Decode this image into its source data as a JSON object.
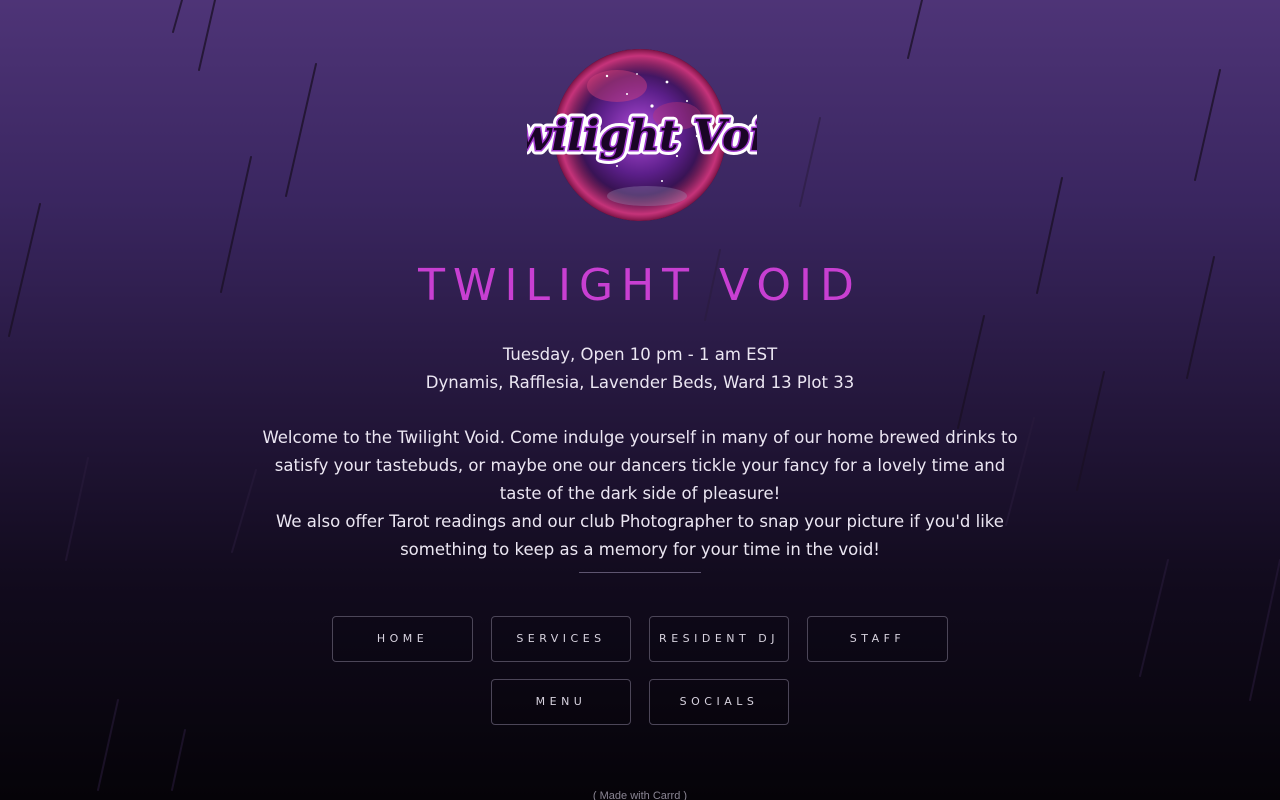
{
  "logo": {
    "text": "Twilight Void"
  },
  "header": {
    "title": "TWILIGHT VOID"
  },
  "info": {
    "hours": "Tuesday, Open 10 pm - 1 am EST",
    "location": "Dynamis, Rafflesia, Lavender Beds, Ward 13 Plot 33"
  },
  "about": {
    "paragraph_1": "Welcome to the Twilight Void. Come indulge yourself in many of our home brewed drinks to satisfy your tastebuds, or maybe one our dancers tickle your fancy for a lovely time and taste of the dark side of pleasure!",
    "paragraph_2": "We also offer Tarot readings and our club Photographer to snap your picture if you'd like something to keep as a memory for your time in the void!"
  },
  "nav": {
    "home": "HOME",
    "services": "SERVICES",
    "resident_dj": "RESIDENT DJ",
    "staff": "STAFF",
    "menu": "MENU",
    "socials": "SOCIALS"
  },
  "footer": {
    "credit": "( Made with Carrd )"
  },
  "colors": {
    "title": "#c83fd2",
    "background_top": "#4e3477",
    "background_bottom": "#050308",
    "button_border": "#4c4658"
  }
}
